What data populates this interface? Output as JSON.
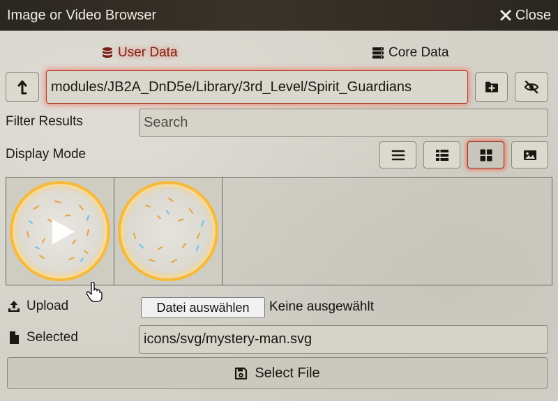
{
  "window": {
    "title": "Image or Video Browser",
    "close_label": "Close",
    "close_icon": "times-icon"
  },
  "tabs": [
    {
      "label": "User Data",
      "icon": "database-icon",
      "active": true
    },
    {
      "label": "Core Data",
      "icon": "server-icon",
      "active": false
    }
  ],
  "path": {
    "value": "modules/JB2A_DnD5e/Library/3rd_Level/Spirit_Guardians",
    "up_icon": "level-up-icon",
    "new_folder_icon": "folder-plus-icon",
    "privacy_icon": "eye-slash-icon"
  },
  "filter": {
    "label": "Filter Results",
    "placeholder": "Search",
    "value": ""
  },
  "display_mode": {
    "label": "Display Mode",
    "modes": [
      {
        "name": "list",
        "icon": "bars-icon",
        "active": false
      },
      {
        "name": "thumbs",
        "icon": "th-list-icon",
        "active": false
      },
      {
        "name": "tiles",
        "icon": "th-large-icon",
        "active": true
      },
      {
        "name": "images",
        "icon": "image-icon",
        "active": false
      }
    ]
  },
  "results": [
    {
      "kind": "video",
      "icon": "play-icon"
    },
    {
      "kind": "video",
      "icon": ""
    }
  ],
  "upload": {
    "label": "Upload",
    "icon": "file-upload-icon",
    "choose_button": "Datei auswählen",
    "status": "Keine ausgewählt"
  },
  "selected": {
    "label": "Selected",
    "icon": "file-icon",
    "value": "icons/svg/mystery-man.svg"
  },
  "submit": {
    "label": "Select File",
    "icon": "save-icon"
  },
  "colors": {
    "accent_glow": "#ff5a3c",
    "titlebar": "#2a2620",
    "panel": "#d4d2c8"
  }
}
